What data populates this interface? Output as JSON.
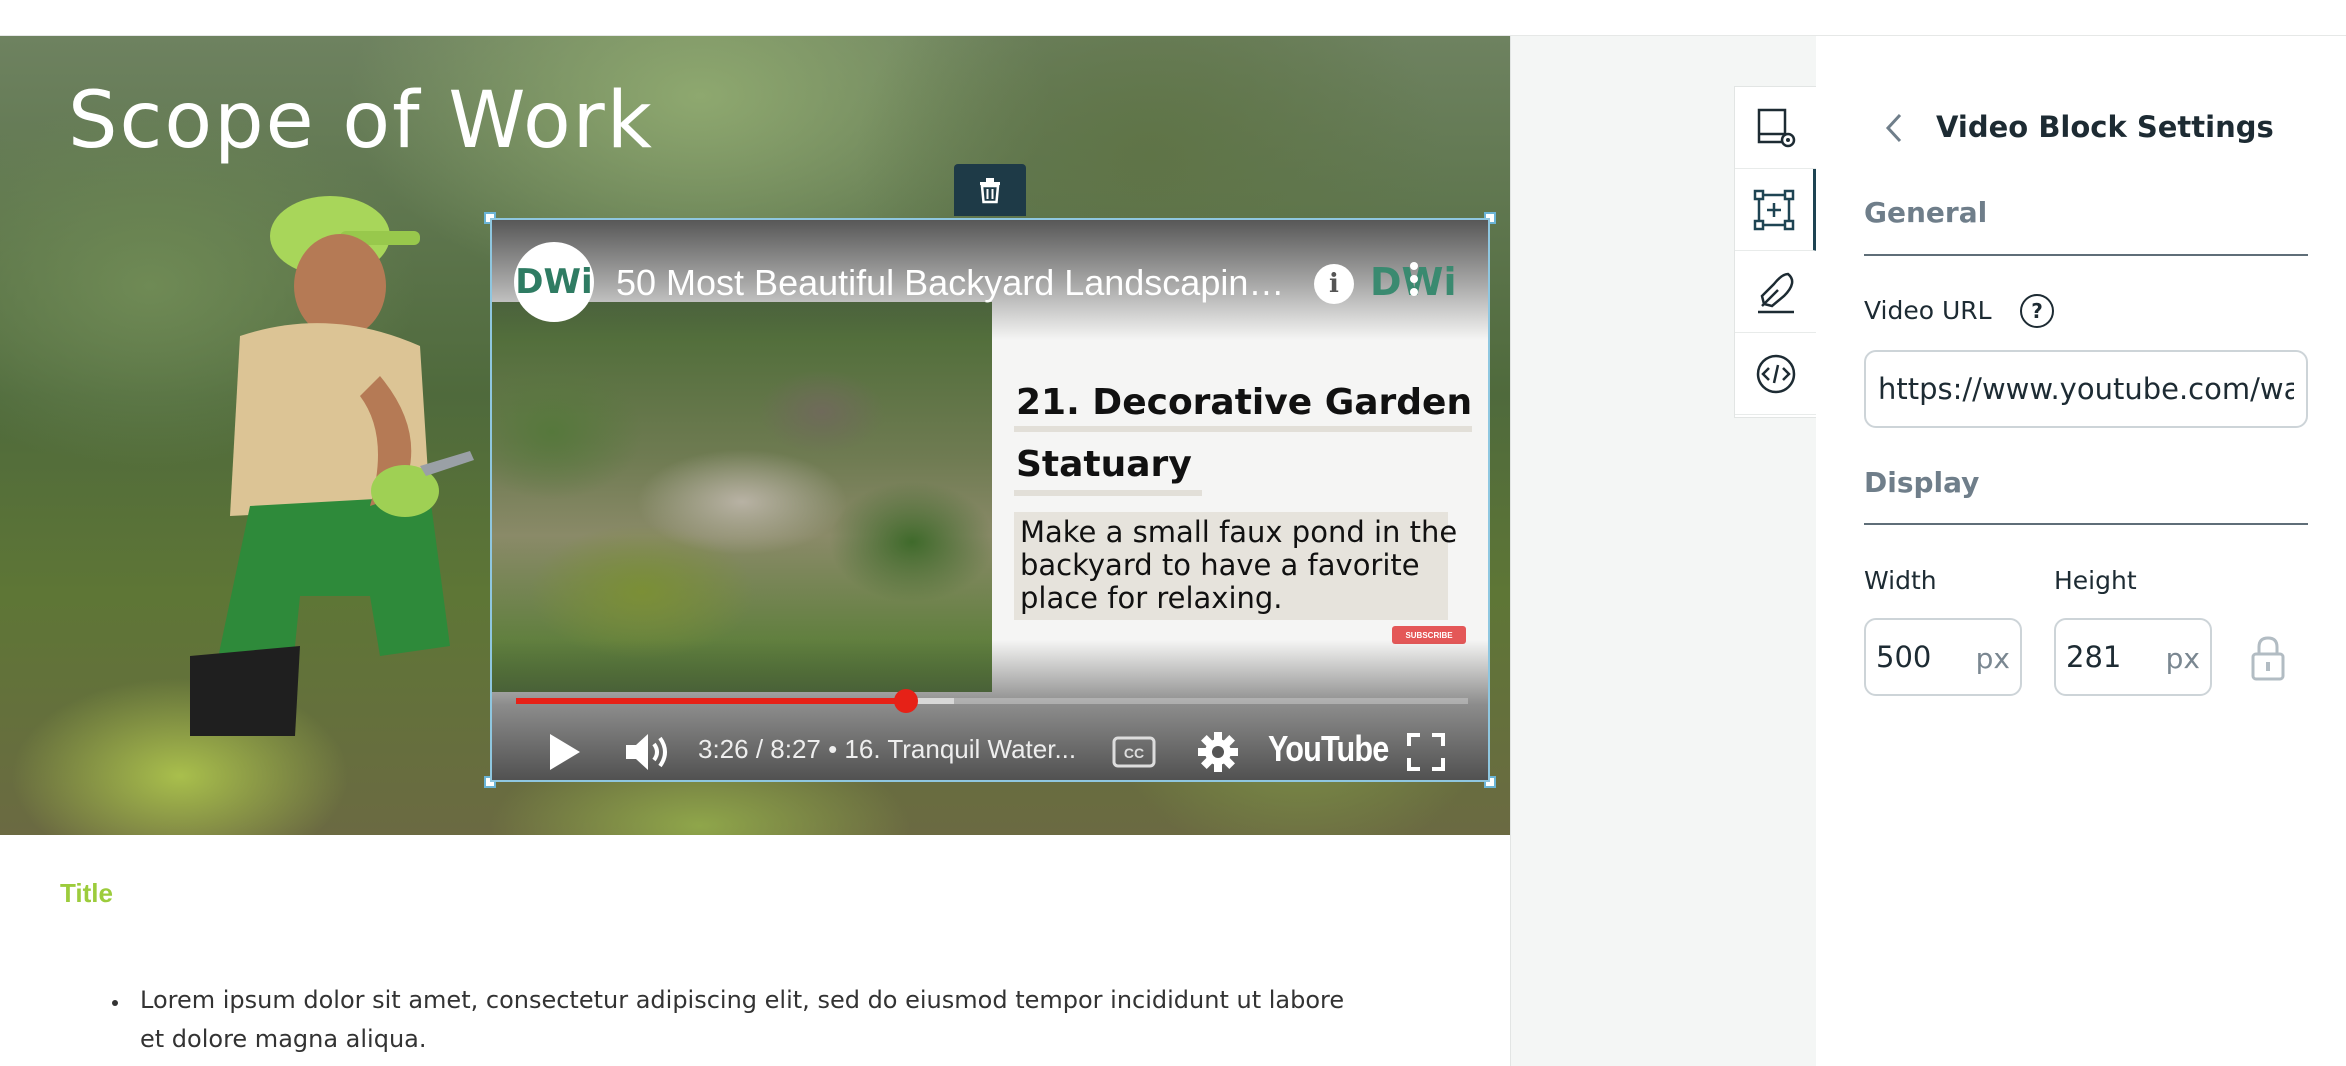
{
  "canvas": {
    "hero_title": "Scope of Work",
    "section_title": "Title",
    "bullet_text": "Lorem ipsum dolor sit amet, consectetur adipiscing elit, sed do eiusmod tempor incididunt ut labore et dolore magna aliqua."
  },
  "video": {
    "channel_logo": "DWi",
    "title": "50 Most Beautiful Backyard Landscaping...",
    "info_label": "i",
    "overlay_logo": "DWi",
    "slide_heading": "21. Decorative Garden Statuary",
    "slide_text": "Make a small faux pond in the backyard to have a favorite place for relaxing.",
    "subscribe_label": "SUBSCRIBE",
    "time": "3:26 / 8:27 • 16. Tranquil Water...",
    "progress_fraction": 0.41,
    "buffered_fraction": 0.46,
    "brand": "YouTube",
    "icons": [
      "play-icon",
      "volume-icon",
      "captions-icon",
      "settings-gear-icon",
      "fullscreen-icon"
    ]
  },
  "tools": [
    "page-settings-icon",
    "add-block-icon",
    "design-pen-icon",
    "code-embed-icon"
  ],
  "panel": {
    "title": "Video Block Settings",
    "general_heading": "General",
    "video_url_label": "Video URL",
    "help_label": "?",
    "video_url_value": "https://www.youtube.com/watch",
    "display_heading": "Display",
    "width_label": "Width",
    "width_value": "500",
    "width_unit": "px",
    "height_label": "Height",
    "height_value": "281",
    "height_unit": "px"
  },
  "colors": {
    "accent_green": "#9ccc3c",
    "dark_teal": "#1e3a47",
    "progress_red": "#e62117"
  }
}
